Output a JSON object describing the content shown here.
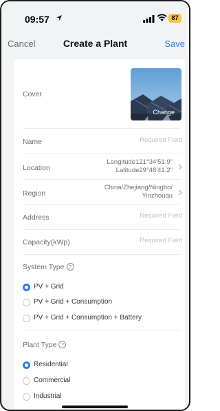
{
  "status_bar": {
    "time": "09:57",
    "battery": "87"
  },
  "nav": {
    "cancel": "Cancel",
    "title": "Create a Plant",
    "save": "Save"
  },
  "form": {
    "cover_label": "Cover",
    "change_label": "Change",
    "name_label": "Name",
    "name_placeholder": "Required Field",
    "location_label": "Location",
    "location_longitude": "Longitude121°34'51.9\"",
    "location_latitude": "Latitude29°48'41.2\"",
    "region_label": "Region",
    "region_line1": "China/Zhejiang/Ningbo/",
    "region_line2": "Yinzhouqu",
    "address_label": "Address",
    "address_placeholder": "Required Field",
    "capacity_label": "Capacity(kWp)",
    "capacity_placeholder": "Required Field",
    "system_type_label": "System Type",
    "system_type_options": [
      "PV + Grid",
      "PV + Grid + Consumption",
      "PV + Grid + Consumption + Battery"
    ],
    "plant_type_label": "Plant Type",
    "plant_type_options": [
      "Residential",
      "Commercial",
      "Industrial"
    ],
    "help_glyph": "?"
  },
  "colors": {
    "accent": "#2f7bf5",
    "battery": "#f6c53c"
  }
}
